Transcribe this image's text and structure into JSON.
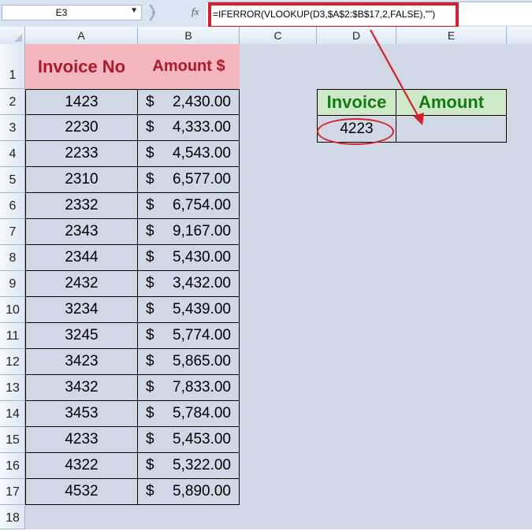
{
  "formula_bar": {
    "name_box": "E3",
    "fx_label": "fx",
    "formula": "=IFERROR(VLOOKUP(D3,$A$2:$B$17,2,FALSE),\"\")"
  },
  "columns": [
    "A",
    "B",
    "C",
    "D",
    "E"
  ],
  "rows": [
    "1",
    "2",
    "3",
    "4",
    "5",
    "6",
    "7",
    "8",
    "9",
    "10",
    "11",
    "12",
    "13",
    "14",
    "15",
    "16",
    "17",
    "18"
  ],
  "table": {
    "header_invoice": "Invoice No",
    "header_amount": "Amount $",
    "currency_symbol": "$",
    "rows": [
      {
        "invoice": "1423",
        "amount": "2,430.00"
      },
      {
        "invoice": "2230",
        "amount": "4,333.00"
      },
      {
        "invoice": "2233",
        "amount": "4,543.00"
      },
      {
        "invoice": "2310",
        "amount": "6,577.00"
      },
      {
        "invoice": "2332",
        "amount": "6,754.00"
      },
      {
        "invoice": "2343",
        "amount": "9,167.00"
      },
      {
        "invoice": "2344",
        "amount": "5,430.00"
      },
      {
        "invoice": "2432",
        "amount": "3,432.00"
      },
      {
        "invoice": "3234",
        "amount": "5,439.00"
      },
      {
        "invoice": "3245",
        "amount": "5,774.00"
      },
      {
        "invoice": "3423",
        "amount": "5,865.00"
      },
      {
        "invoice": "3432",
        "amount": "7,833.00"
      },
      {
        "invoice": "3453",
        "amount": "5,784.00"
      },
      {
        "invoice": "4233",
        "amount": "5,453.00"
      },
      {
        "invoice": "4322",
        "amount": "5,322.00"
      },
      {
        "invoice": "4532",
        "amount": "5,890.00"
      }
    ]
  },
  "lookup": {
    "header_invoice": "Invoice",
    "header_amount": "Amount",
    "invoice_value": "4223",
    "amount_value": ""
  },
  "colors": {
    "table_header_bg": "#f4b7c0",
    "table_header_text": "#b0172a",
    "lookup_header_bg": "#cde9c8",
    "lookup_header_text": "#137b13",
    "annotation_red": "#d8202a"
  }
}
